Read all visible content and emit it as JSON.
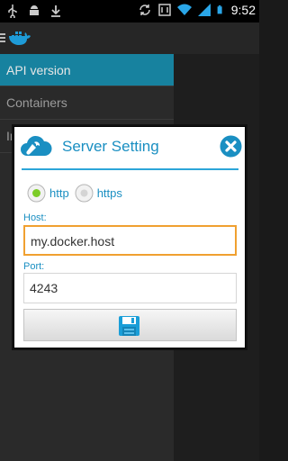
{
  "status_bar": {
    "time": "9:52",
    "icons": [
      "usb-icon",
      "android-debug-icon",
      "download-icon",
      "sync-icon",
      "nfc-icon",
      "wifi-icon",
      "signal-icon",
      "battery-icon"
    ]
  },
  "app_bar": {
    "icons": [
      "menu-icon",
      "docker-logo-icon"
    ]
  },
  "drawer": {
    "items": [
      {
        "label": "API version",
        "active": true
      },
      {
        "label": "Containers",
        "active": false
      },
      {
        "label": "Images",
        "active": false
      }
    ]
  },
  "dialog": {
    "title": "Server Setting",
    "protocol": {
      "options": [
        {
          "label": "http",
          "selected": true
        },
        {
          "label": "https",
          "selected": false
        }
      ]
    },
    "host": {
      "label": "Host:",
      "value": "my.docker.host"
    },
    "port": {
      "label": "Port:",
      "value": "4243"
    },
    "save_icon": "floppy-disk-icon"
  },
  "colors": {
    "accent": "#1a8fc2",
    "focus": "#f0a030",
    "drawer_active": "#17829f"
  }
}
